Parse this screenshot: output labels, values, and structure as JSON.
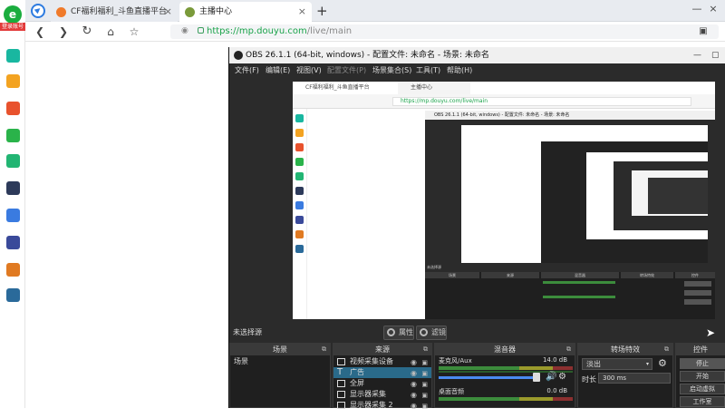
{
  "browser": {
    "tabs": [
      {
        "label": "CF福利福利_斗鱼直播平台",
        "close": "×"
      },
      {
        "label": "主播中心",
        "close": "×"
      }
    ],
    "new_tab": "+",
    "url_host": "https://mp.douyu.com",
    "url_path": "/live/main",
    "sidebar_logo": "e",
    "login_badge": "登录账号",
    "sidebar_colors": [
      "#19b7a0",
      "#f3a321",
      "#e8522d",
      "#2ab34a",
      "#22b573",
      "#2d3a5a",
      "#3a7be0",
      "#3a4a9a",
      "#e07a22",
      "#2a6a9a"
    ],
    "win_min": "—",
    "win_close": "×"
  },
  "obs": {
    "title": "OBS 26.1.1 (64-bit, windows) - 配置文件: 未命名 - 场景: 未命名",
    "menu": [
      "文件(F)",
      "编辑(E)",
      "视图(V)",
      "配置文件(P)",
      "场景集合(S)",
      "工具(T)",
      "帮助(H)"
    ],
    "no_source_selected": "未选择源",
    "properties_button": "属性",
    "filters_button": "滤镜",
    "docks": {
      "scenes": {
        "title": "场景",
        "items": [
          "场景"
        ]
      },
      "sources": {
        "title": "来源",
        "items": [
          {
            "label": "视频采集设备",
            "icon": "camera-icon"
          },
          {
            "label": "广告",
            "icon": "text-icon"
          },
          {
            "label": "全屏",
            "icon": "monitor-icon"
          },
          {
            "label": "显示器采集",
            "icon": "monitor-icon"
          },
          {
            "label": "显示器采集 2",
            "icon": "monitor-icon"
          }
        ]
      },
      "mixer": {
        "title": "混音器",
        "channels": [
          {
            "name": "麦克风/Aux",
            "db": "14.0 dB"
          },
          {
            "name": "桌面音频",
            "db": "0.0 dB"
          }
        ]
      },
      "transitions": {
        "title": "转场特效",
        "type": "淡出",
        "duration_label": "时长",
        "duration_value": "300 ms"
      },
      "controls": {
        "title": "控件",
        "buttons": [
          "停止",
          "开始",
          "启动虚拟",
          "工作室"
        ]
      }
    }
  },
  "preview": {
    "tab1": "CF福利福利_斗鱼直播平台",
    "tab2": "主播中心",
    "url": "https://mp.douyu.com/live/main",
    "nested_title": "OBS 26.1.1 (64-bit, windows) - 配置文件: 未命名 - 场景: 未命名",
    "nested_no_source": "未选择源",
    "nested_scenes": "场景",
    "nested_sources": "来源",
    "nested_mixer": "混音器",
    "nested_transitions": "转场特效",
    "nested_controls": "控件"
  }
}
